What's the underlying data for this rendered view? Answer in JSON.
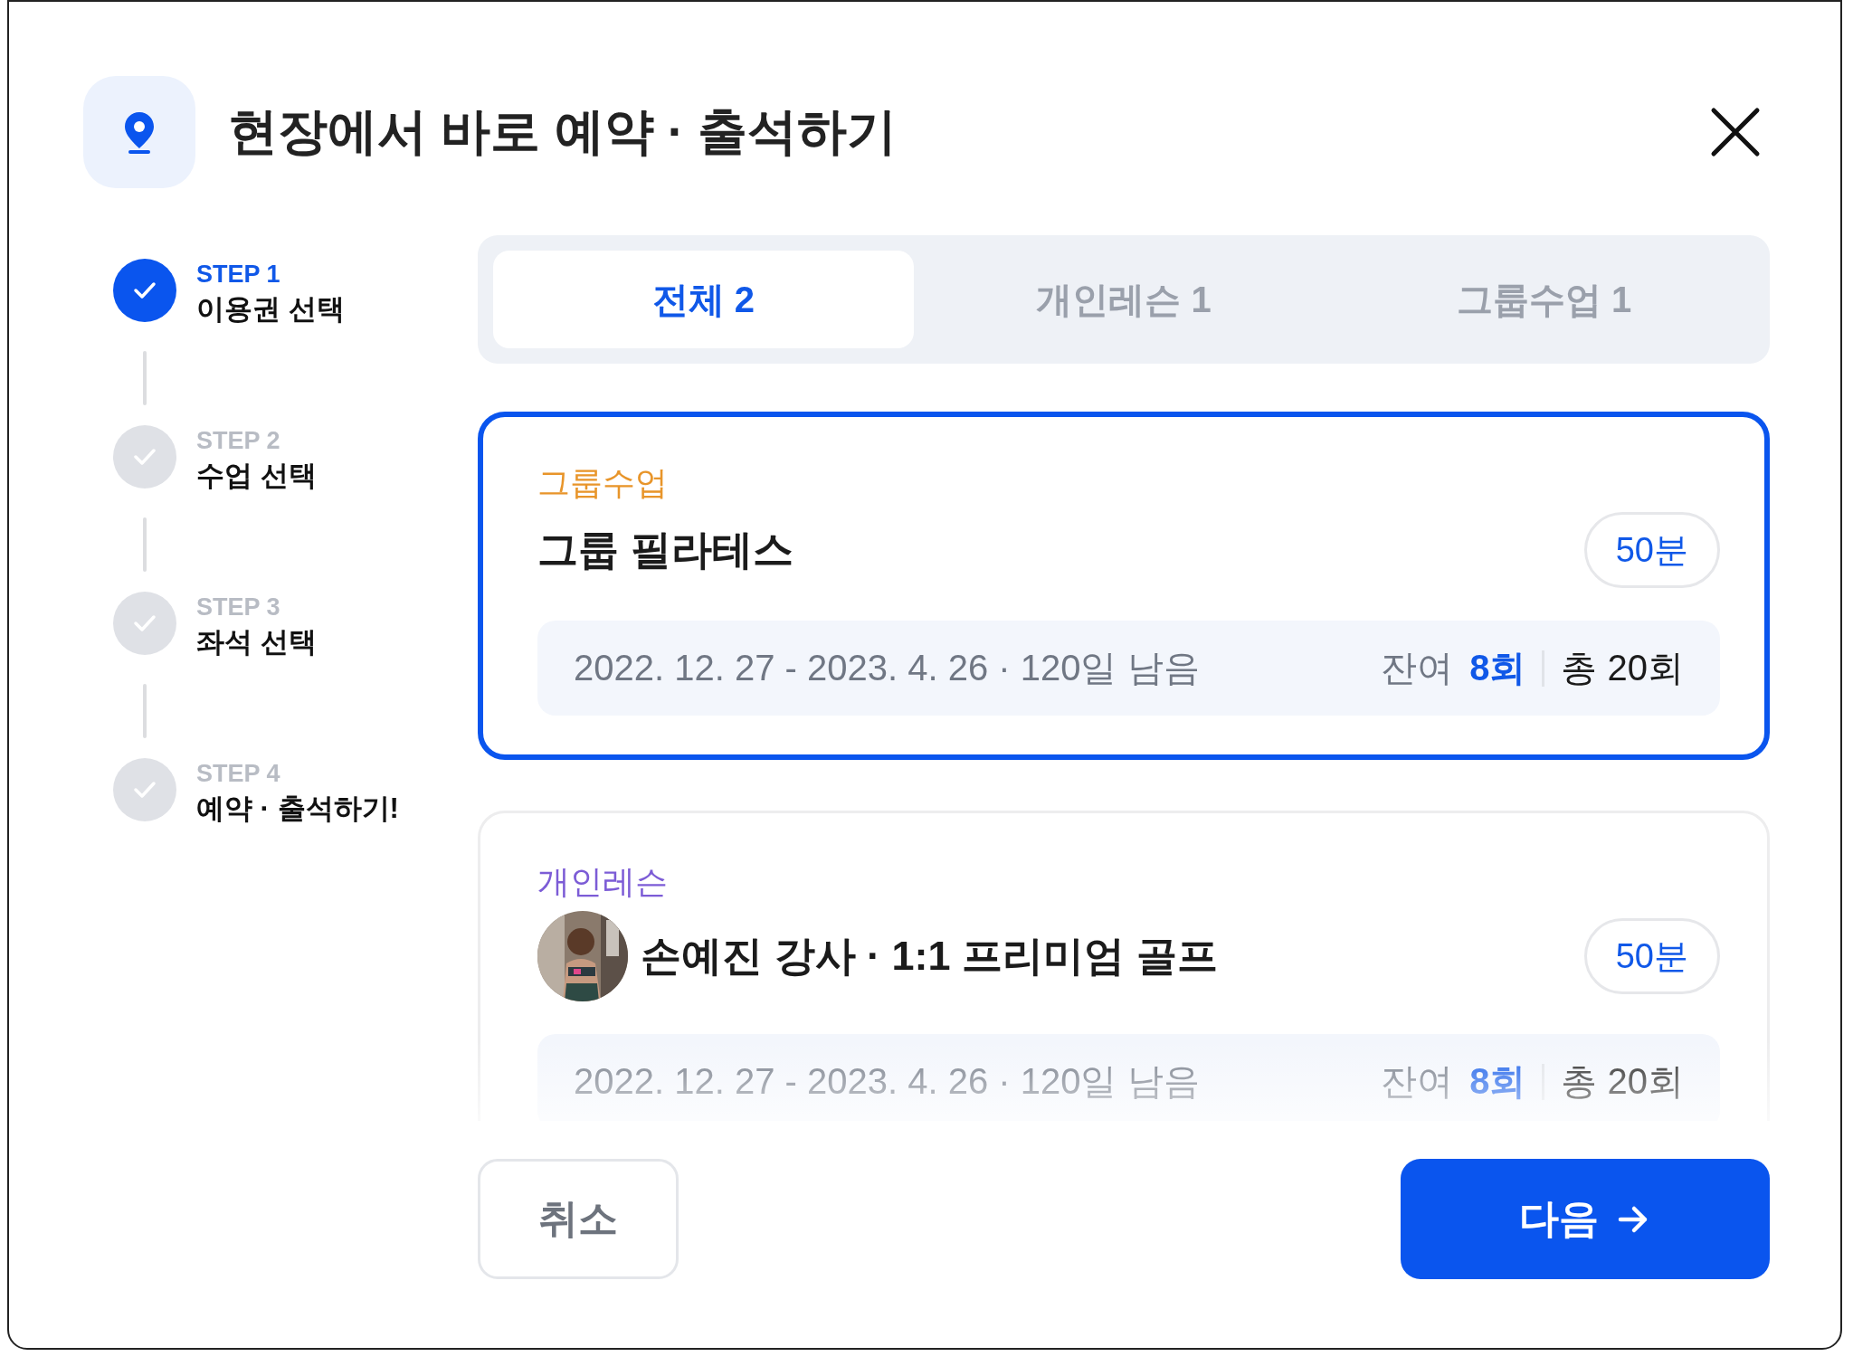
{
  "header": {
    "title": "현장에서 바로 예약 · 출석하기"
  },
  "steps": [
    {
      "label": "STEP 1",
      "name": "이용권 선택",
      "done": true
    },
    {
      "label": "STEP 2",
      "name": "수업 선택",
      "done": false
    },
    {
      "label": "STEP 3",
      "name": "좌석 선택",
      "done": false
    },
    {
      "label": "STEP 4",
      "name": "예약 · 출석하기!",
      "done": false
    }
  ],
  "tabs": [
    {
      "label": "전체 2",
      "selected": true
    },
    {
      "label": "개인레슨 1",
      "selected": false
    },
    {
      "label": "그룹수업 1",
      "selected": false
    }
  ],
  "passes": [
    {
      "kind": "group",
      "selected": true,
      "category": "그룹수업",
      "color": "#e8952a",
      "title": "그룹 필라테스",
      "duration": "50분",
      "period": "2022. 12. 27 - 2023. 4. 26 · 120일 남음",
      "remaining_label": "잔여",
      "remaining": "8회",
      "total": "총 20회"
    },
    {
      "kind": "personal",
      "selected": false,
      "category": "개인레슨",
      "color": "#7c5cd6",
      "title": "손예진 강사 · 1:1 프리미엄 골프",
      "duration": "50분",
      "period": "2022. 12. 27 - 2023. 4. 26 · 120일 남음",
      "remaining_label": "잔여",
      "remaining": "8회",
      "total": "총 20회"
    }
  ],
  "buttons": {
    "cancel": "취소",
    "next": "다음"
  }
}
